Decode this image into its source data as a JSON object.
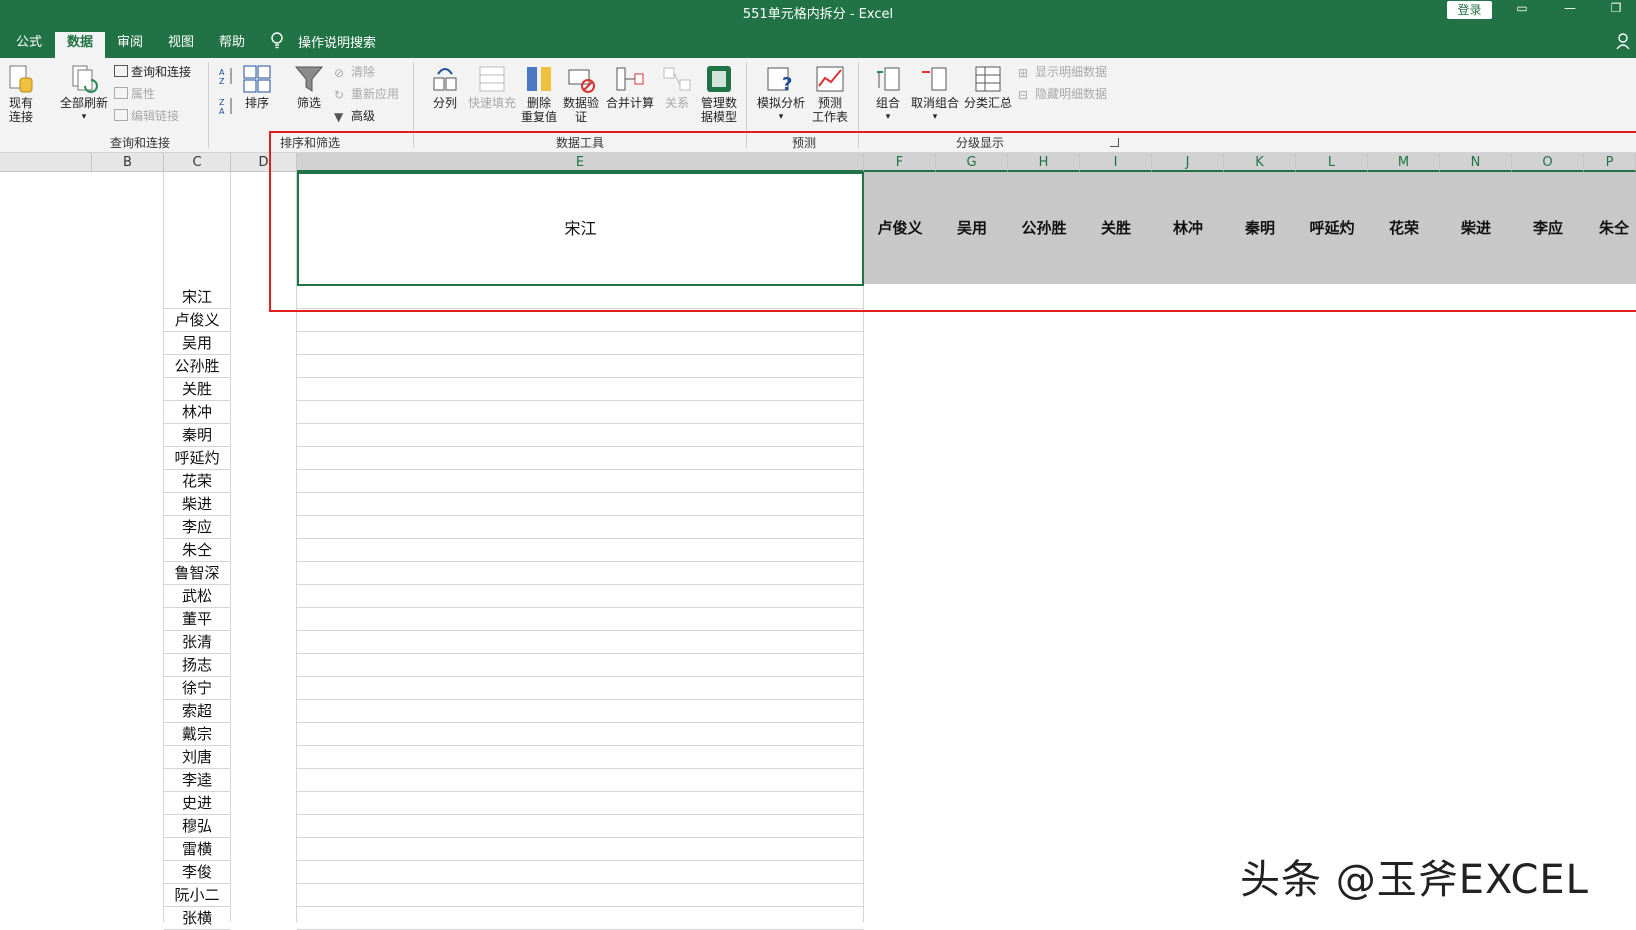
{
  "window": {
    "title": "551单元格内拆分  -  Excel",
    "login": "登录",
    "minimize": "—",
    "restore": "❐"
  },
  "tabs": [
    {
      "label": "公式"
    },
    {
      "label": "数据"
    },
    {
      "label": "审阅"
    },
    {
      "label": "视图"
    },
    {
      "label": "帮助"
    }
  ],
  "tell_me": "操作说明搜索",
  "ribbon": {
    "existing_conn": "现有\n连接",
    "refresh_all": "全部刷新",
    "queries_conn": "查询和连接",
    "properties": "属性",
    "edit_links": "编辑链接",
    "group_queries": "查询和连接",
    "sort": "排序",
    "filter": "筛选",
    "clear": "清除",
    "reapply": "重新应用",
    "advanced": "高级",
    "group_sort": "排序和筛选",
    "text_to_columns": "分列",
    "flash_fill": "快速填充",
    "remove_dup": "删除\n重复值",
    "data_validation": "数据验\n证",
    "consolidate": "合并计算",
    "relationships": "关系",
    "data_model": "管理数\n据模型",
    "group_tools": "数据工具",
    "what_if": "模拟分析",
    "forecast": "预测\n工作表",
    "group_forecast": "预测",
    "group_btn": "组合",
    "ungroup": "取消组合",
    "subtotal": "分类汇总",
    "show_detail": "显示明细数据",
    "hide_detail": "隐藏明细数据",
    "group_outline": "分级显示"
  },
  "columns": [
    "B",
    "C",
    "D",
    "E",
    "F",
    "G",
    "H",
    "I",
    "J",
    "K",
    "L",
    "M",
    "N",
    "O",
    "P"
  ],
  "merged_cell": "宋江",
  "header_names": [
    "卢俊义",
    "吴用",
    "公孙胜",
    "关胜",
    "林冲",
    "秦明",
    "呼延灼",
    "花荣",
    "柴进",
    "李应",
    "朱仝"
  ],
  "names": [
    "宋江",
    "卢俊义",
    "吴用",
    "公孙胜",
    "关胜",
    "林冲",
    "秦明",
    "呼延灼",
    "花荣",
    "柴进",
    "李应",
    "朱仝",
    "鲁智深",
    "武松",
    "董平",
    "张清",
    "扬志",
    "徐宁",
    "索超",
    "戴宗",
    "刘唐",
    "李逵",
    "史进",
    "穆弘",
    "雷横",
    "李俊",
    "阮小二",
    "张横"
  ],
  "watermark": "头条 @玉斧EXCEL",
  "colors": {
    "excel_green": "#217346",
    "highlight_red": "#e02020"
  }
}
